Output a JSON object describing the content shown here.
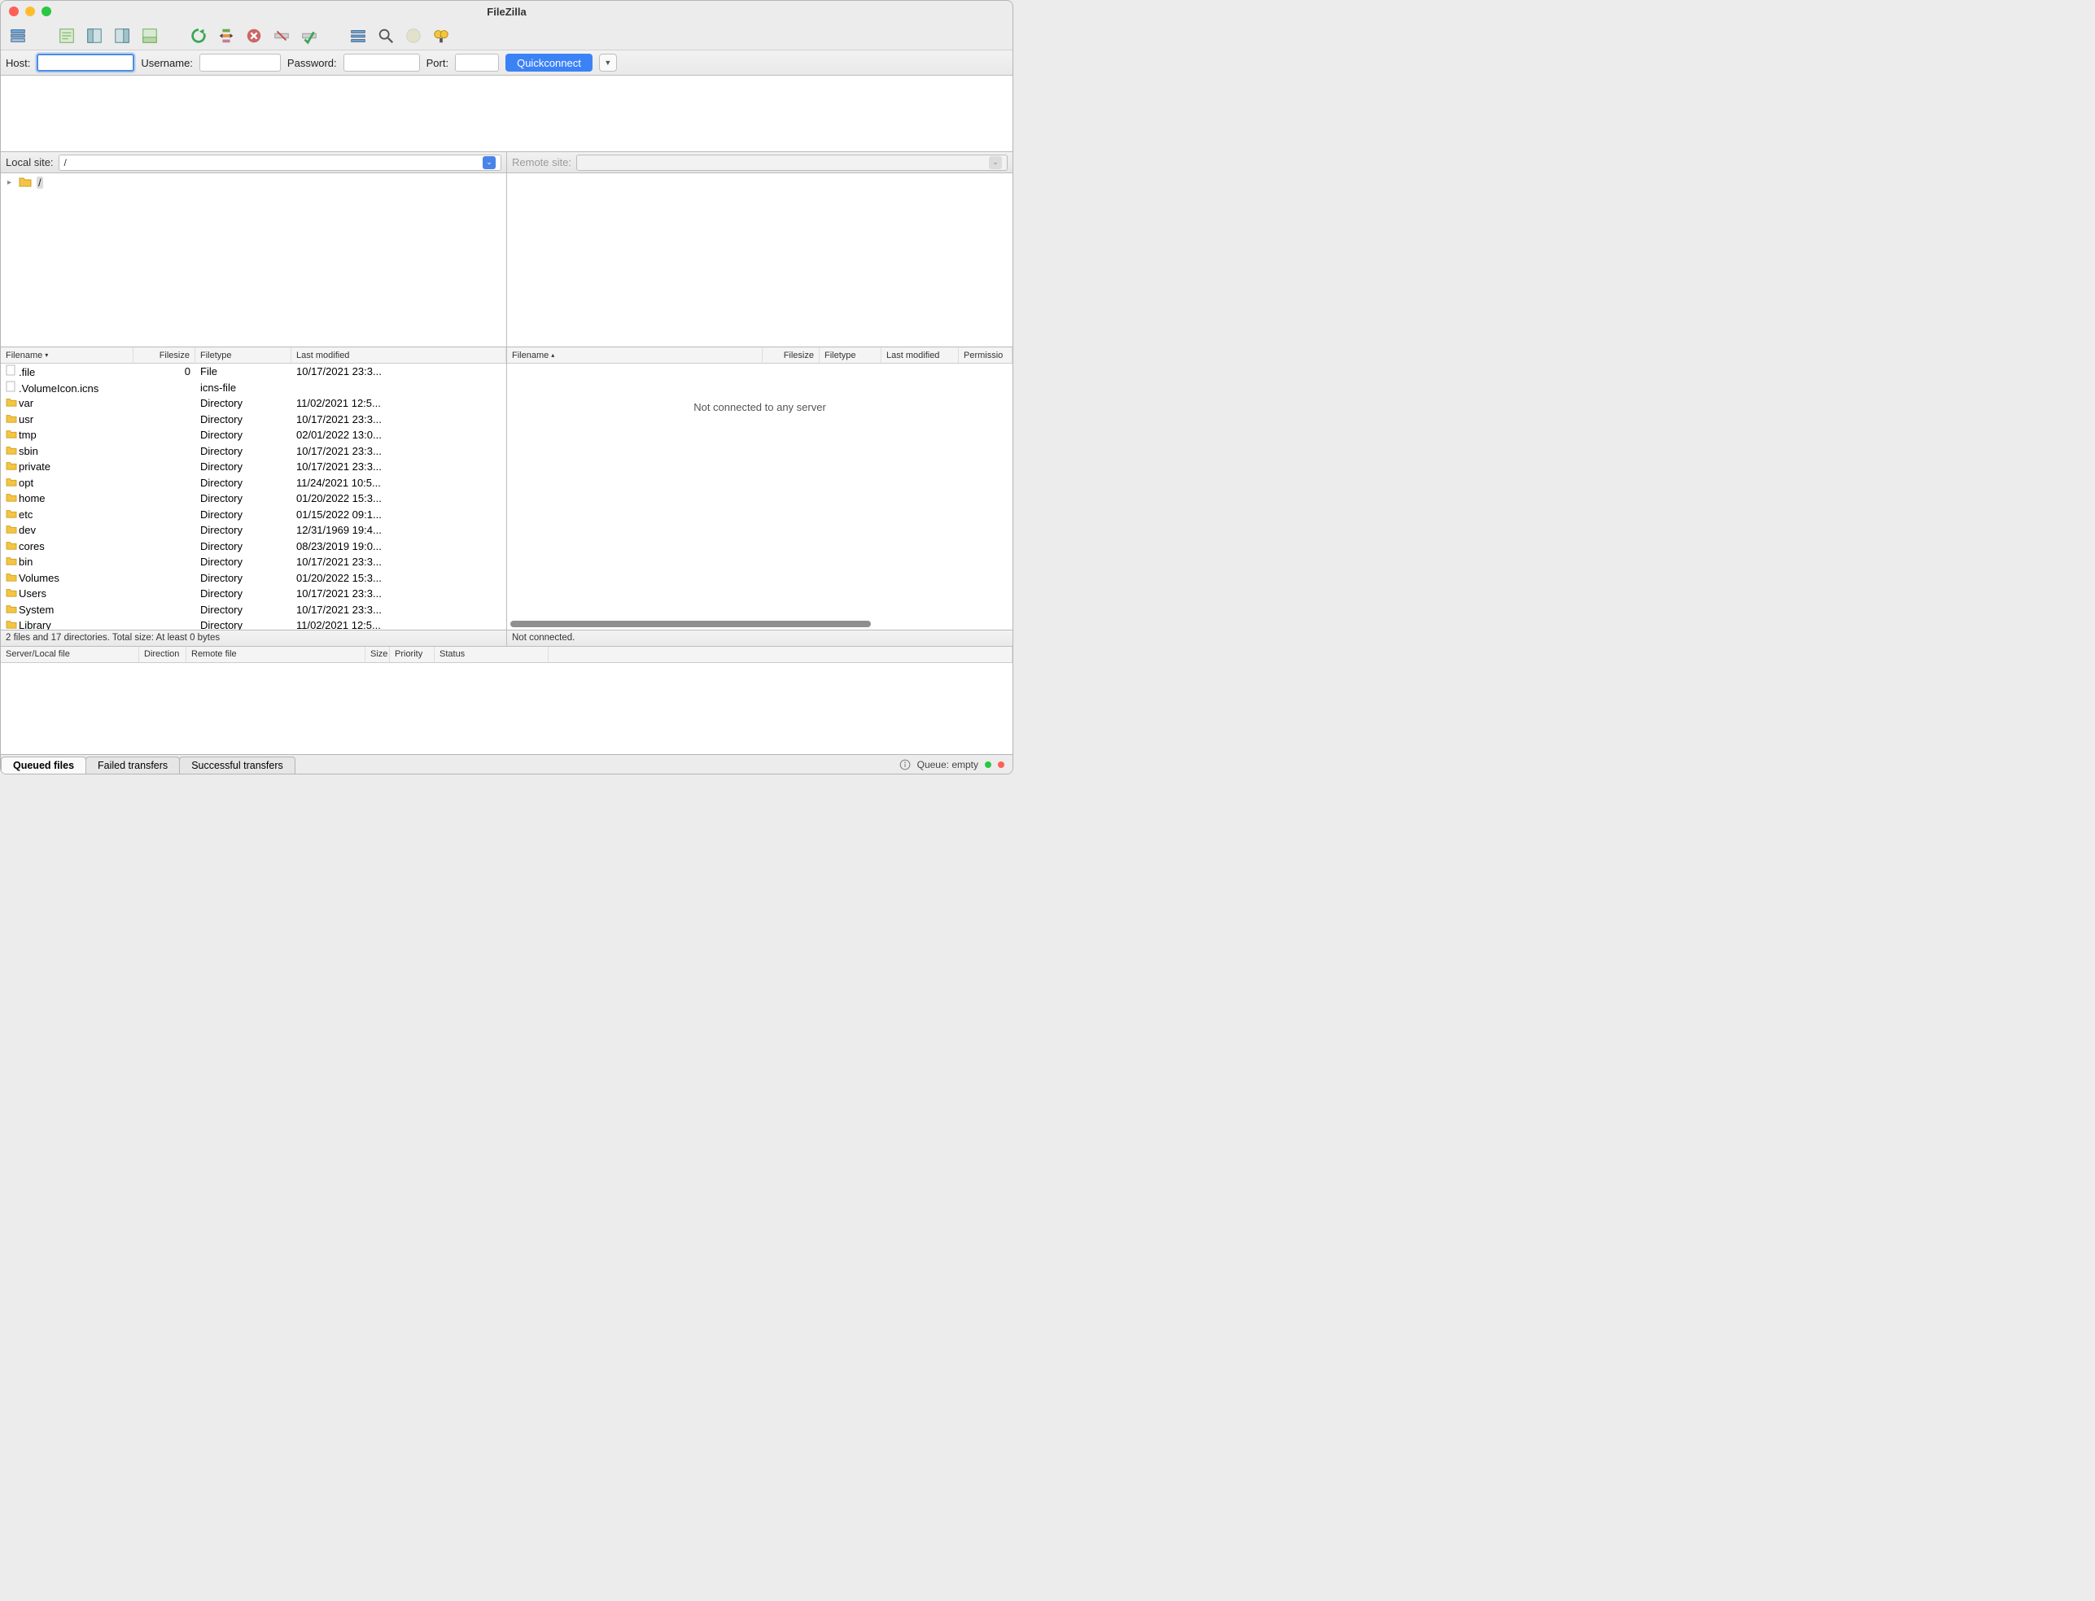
{
  "title": "FileZilla",
  "quickconnect": {
    "host_label": "Host:",
    "host_value": "",
    "username_label": "Username:",
    "username_value": "",
    "password_label": "Password:",
    "password_value": "",
    "port_label": "Port:",
    "port_value": "",
    "connect_label": "Quickconnect"
  },
  "local": {
    "label": "Local site:",
    "path": "/",
    "tree_root": "/",
    "columns": {
      "name": "Filename",
      "size": "Filesize",
      "type": "Filetype",
      "mod": "Last modified"
    },
    "files": [
      {
        "name": ".file",
        "size": "0",
        "type": "File",
        "mod": "10/17/2021 23:3...",
        "icon": "doc"
      },
      {
        "name": ".VolumeIcon.icns",
        "size": "",
        "type": "icns-file",
        "mod": "",
        "icon": "doc"
      },
      {
        "name": "var",
        "size": "",
        "type": "Directory",
        "mod": "11/02/2021 12:5...",
        "icon": "dir"
      },
      {
        "name": "usr",
        "size": "",
        "type": "Directory",
        "mod": "10/17/2021 23:3...",
        "icon": "dir"
      },
      {
        "name": "tmp",
        "size": "",
        "type": "Directory",
        "mod": "02/01/2022 13:0...",
        "icon": "dir"
      },
      {
        "name": "sbin",
        "size": "",
        "type": "Directory",
        "mod": "10/17/2021 23:3...",
        "icon": "dir"
      },
      {
        "name": "private",
        "size": "",
        "type": "Directory",
        "mod": "10/17/2021 23:3...",
        "icon": "dir"
      },
      {
        "name": "opt",
        "size": "",
        "type": "Directory",
        "mod": "11/24/2021 10:5...",
        "icon": "dir"
      },
      {
        "name": "home",
        "size": "",
        "type": "Directory",
        "mod": "01/20/2022 15:3...",
        "icon": "dir"
      },
      {
        "name": "etc",
        "size": "",
        "type": "Directory",
        "mod": "01/15/2022 09:1...",
        "icon": "dir"
      },
      {
        "name": "dev",
        "size": "",
        "type": "Directory",
        "mod": "12/31/1969 19:4...",
        "icon": "dir"
      },
      {
        "name": "cores",
        "size": "",
        "type": "Directory",
        "mod": "08/23/2019 19:0...",
        "icon": "dir"
      },
      {
        "name": "bin",
        "size": "",
        "type": "Directory",
        "mod": "10/17/2021 23:3...",
        "icon": "dir"
      },
      {
        "name": "Volumes",
        "size": "",
        "type": "Directory",
        "mod": "01/20/2022 15:3...",
        "icon": "dir"
      },
      {
        "name": "Users",
        "size": "",
        "type": "Directory",
        "mod": "10/17/2021 23:3...",
        "icon": "dir"
      },
      {
        "name": "System",
        "size": "",
        "type": "Directory",
        "mod": "10/17/2021 23:3...",
        "icon": "dir"
      },
      {
        "name": "Library",
        "size": "",
        "type": "Directory",
        "mod": "11/02/2021 12:5...",
        "icon": "dir"
      }
    ],
    "status": "2 files and 17 directories. Total size: At least 0 bytes"
  },
  "remote": {
    "label": "Remote site:",
    "path": "",
    "columns": {
      "name": "Filename",
      "size": "Filesize",
      "type": "Filetype",
      "mod": "Last modified",
      "perm": "Permissio"
    },
    "placeholder": "Not connected to any server",
    "status": "Not connected."
  },
  "queue": {
    "columns": {
      "server": "Server/Local file",
      "dir": "Direction",
      "remote": "Remote file",
      "size": "Size",
      "priority": "Priority",
      "status": "Status"
    },
    "tabs": {
      "queued": "Queued files",
      "failed": "Failed transfers",
      "success": "Successful transfers"
    },
    "status": "Queue: empty"
  }
}
